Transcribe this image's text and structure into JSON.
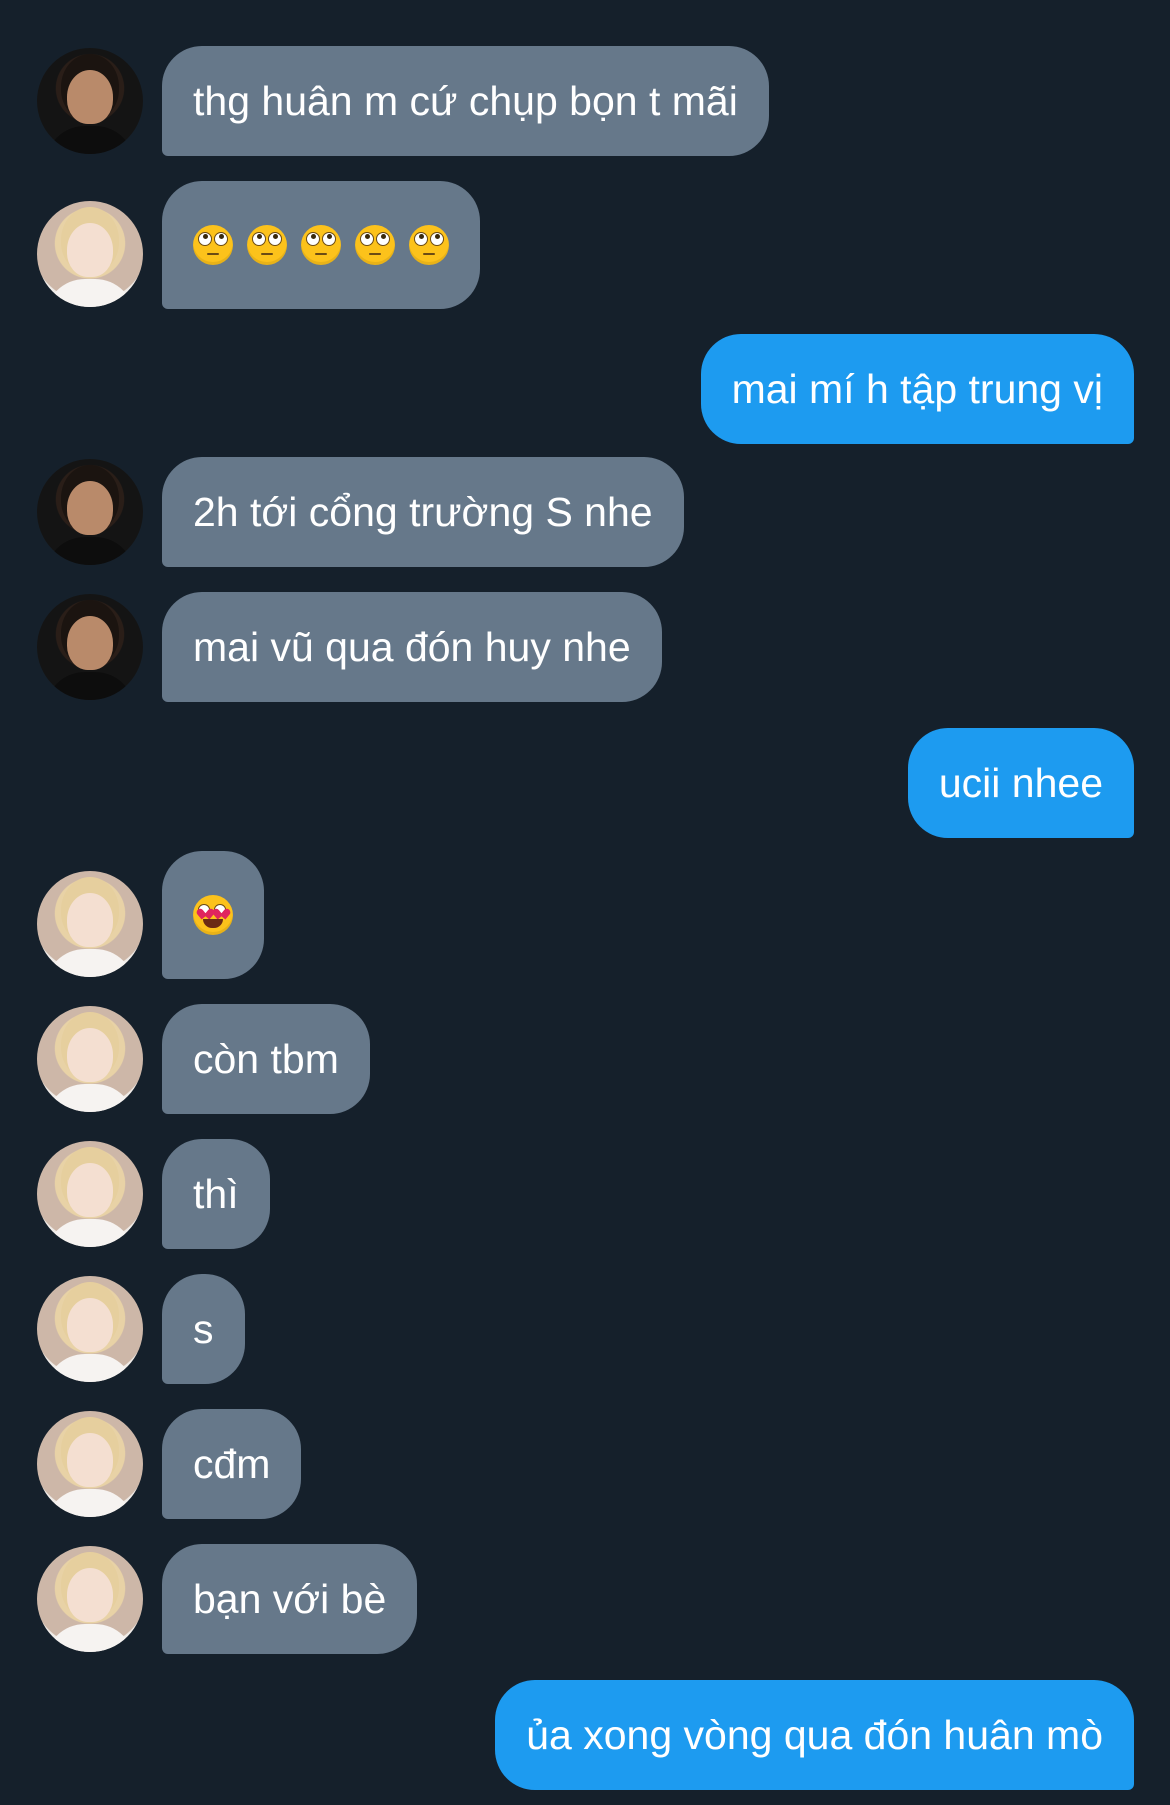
{
  "messages": [
    {
      "sender": "other",
      "avatar": "dark-hair-avatar",
      "text": "thg huân m cứ chụp bọn t mãi"
    },
    {
      "sender": "other",
      "avatar": "blond-hair-avatar",
      "emoji": [
        "face-with-rolling-eyes",
        "face-with-rolling-eyes",
        "face-with-rolling-eyes",
        "face-with-rolling-eyes",
        "face-with-rolling-eyes"
      ]
    },
    {
      "sender": "me",
      "text": "mai mí h tập trung vị"
    },
    {
      "sender": "other",
      "avatar": "dark-hair-avatar",
      "text": "2h tới cổng trường S nhe"
    },
    {
      "sender": "other",
      "avatar": "dark-hair-avatar",
      "text": "mai vũ qua đón huy nhe"
    },
    {
      "sender": "me",
      "text": "ucii nhee"
    },
    {
      "sender": "other",
      "avatar": "blond-hair-avatar",
      "emoji": [
        "smiling-face-with-heart-eyes"
      ]
    },
    {
      "sender": "other",
      "avatar": "blond-hair-avatar",
      "text": "còn tbm"
    },
    {
      "sender": "other",
      "avatar": "blond-hair-avatar",
      "text": "thì"
    },
    {
      "sender": "other",
      "avatar": "blond-hair-avatar",
      "text": "s"
    },
    {
      "sender": "other",
      "avatar": "blond-hair-avatar",
      "text": "cđm"
    },
    {
      "sender": "other",
      "avatar": "blond-hair-avatar",
      "text": "bạn với bè"
    },
    {
      "sender": "me",
      "text": "ủa xong vòng qua đón huân mò"
    }
  ],
  "colors": {
    "background": "#15202b",
    "incoming_bubble": "#66788a",
    "outgoing_bubble": "#1d9bf0",
    "text": "#ffffff"
  }
}
